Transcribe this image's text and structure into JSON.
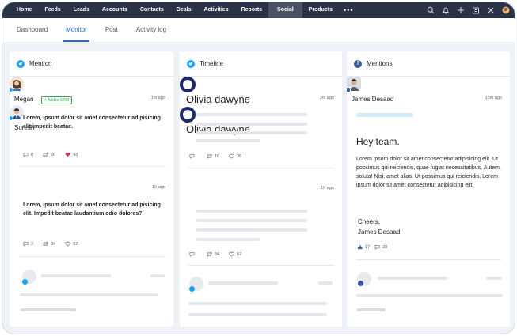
{
  "topnav": {
    "items": [
      "Home",
      "Feeds",
      "Leads",
      "Accounts",
      "Contacts",
      "Deals",
      "Activities",
      "Reports",
      "Social",
      "Products"
    ],
    "active": "Social",
    "more": "•••"
  },
  "subnav": {
    "tabs": [
      "Dashboard",
      "Monitor",
      "Post",
      "Activity log"
    ],
    "active": "Monitor"
  },
  "colors": {
    "twitter": "#1da1f2",
    "facebook": "#3b5998",
    "accent": "#2c67c7",
    "nav": "#2b3346"
  },
  "columns": {
    "mention": {
      "title": "Mention",
      "posts": [
        {
          "name": "Megan",
          "crm": "+ Add to CRM",
          "time": "1m ago",
          "text": "Lorem, ipsum dolor sit amet consectetur adipisicing elit impedit beatae.",
          "comments": "8",
          "retweets": "20",
          "likes": "43"
        },
        {
          "name": "Suresh",
          "time": "1h ago",
          "text": "Lorem, ipsum dolor sit amet consectetur adipisicing elit. Impedit beatae laudantium odio dolores?",
          "comments": "2",
          "retweets": "34",
          "likes": "57"
        }
      ]
    },
    "timeline": {
      "title": "Timeline",
      "posts": [
        {
          "name": "Olivia dawyne",
          "time": "3m ago",
          "comments": "",
          "retweets": "18",
          "likes": "26"
        },
        {
          "name": "Olivia dawyne",
          "time": "1h ago",
          "comments": "",
          "retweets": "34",
          "likes": "57"
        }
      ]
    },
    "mentions": {
      "title": "Mentions",
      "post": {
        "name": "James Desaad",
        "time": "15m ago",
        "greeting": "Hey team.",
        "text": "Lorem ipsum dolor sit amet consectetur adipisicing elit. Ut possimus qui reiciendis, quae fugiat necessitatibus. Autem, soluta! Nisi, amet alias. Ut possimus qui reiciendis, Lorem ipsum dolor sit amet consectetur adipisicing elit.",
        "sign1": "Cheers,",
        "sign2": "James Desaad.",
        "likes": "17",
        "comments": "23"
      }
    }
  }
}
